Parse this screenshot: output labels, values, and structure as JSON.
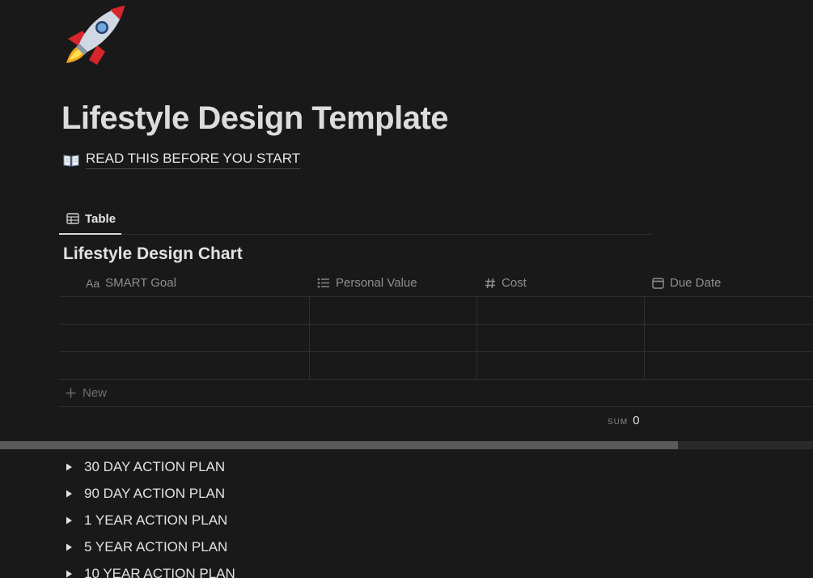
{
  "page": {
    "icon": "rocket-icon",
    "title": "Lifestyle Design Template",
    "read_link": {
      "icon": "open-book-icon",
      "label": "READ THIS BEFORE YOU START"
    }
  },
  "view_tabs": [
    {
      "icon": "table-icon",
      "label": "Table",
      "active": true
    }
  ],
  "database": {
    "title": "Lifestyle Design Chart",
    "columns": [
      {
        "prefix": "Aa",
        "label": "SMART Goal"
      },
      {
        "icon": "list-icon",
        "label": "Personal Value"
      },
      {
        "icon": "hash-icon",
        "label": "Cost"
      },
      {
        "icon": "calendar-icon",
        "label": "Due Date"
      }
    ],
    "rows": [
      [
        "",
        "",
        "",
        ""
      ],
      [
        "",
        "",
        "",
        ""
      ],
      [
        "",
        "",
        "",
        ""
      ]
    ],
    "new_label": "New",
    "sum": {
      "label": "SUM",
      "value": "0"
    }
  },
  "toggles": [
    {
      "label": "30 DAY ACTION PLAN"
    },
    {
      "label": "90 DAY ACTION PLAN"
    },
    {
      "label": "1 YEAR ACTION PLAN"
    },
    {
      "label": "5 YEAR ACTION PLAN"
    },
    {
      "label": "10 YEAR ACTION PLAN"
    }
  ],
  "colors": {
    "background": "#191919",
    "text": "#d4d4d4",
    "muted": "#8f8f8f",
    "divider": "#2f2f2f"
  }
}
